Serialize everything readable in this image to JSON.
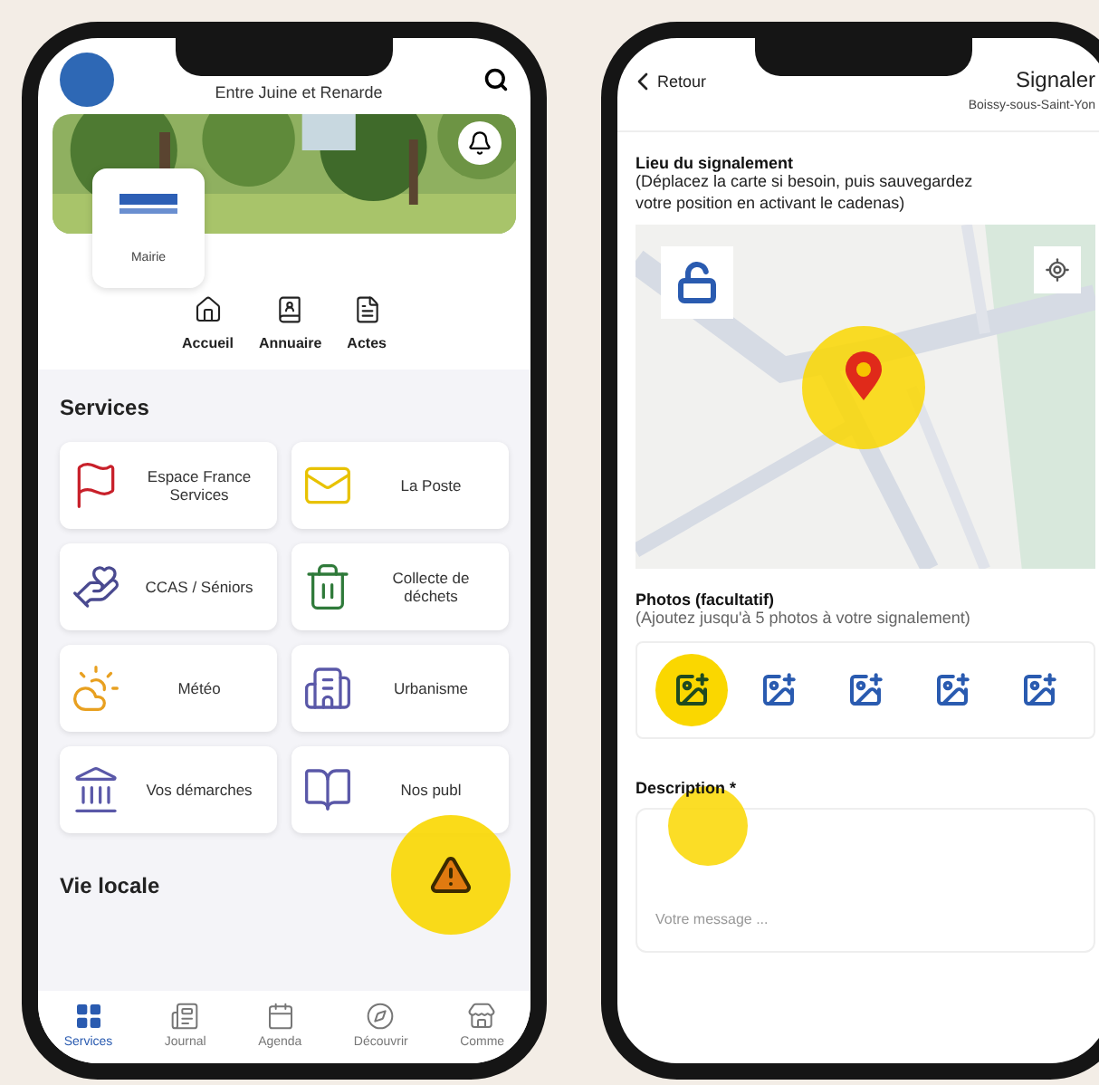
{
  "home_screen": {
    "header": {
      "subtitle": "Entre Juine et Renarde"
    },
    "mairie_card": {
      "label": "Mairie"
    },
    "quick_actions": [
      {
        "label": "Accueil"
      },
      {
        "label": "Annuaire"
      },
      {
        "label": "Actes"
      }
    ],
    "services": {
      "title": "Services",
      "items": [
        {
          "label": "Espace France Services"
        },
        {
          "label": "La Poste"
        },
        {
          "label": "CCAS / Séniors"
        },
        {
          "label": "Collecte de déchets"
        },
        {
          "label": "Météo"
        },
        {
          "label": "Urbanisme"
        },
        {
          "label": "Vos démarches"
        },
        {
          "label": "Nos publ"
        }
      ]
    },
    "report_button": {
      "highlighted": true
    },
    "next_section": "Vie locale",
    "tabs": [
      {
        "label": "Services",
        "selected": true
      },
      {
        "label": "Journal",
        "selected": false
      },
      {
        "label": "Agenda",
        "selected": false
      },
      {
        "label": "Découvrir",
        "selected": false
      },
      {
        "label": "Comme",
        "selected": false
      }
    ]
  },
  "report_screen": {
    "back": "Retour",
    "title": "Signaler",
    "subtitle": "Boissy-sous-Saint-Yon",
    "location": {
      "title": "Lieu du signalement",
      "hint": "(Déplacez la carte si besoin, puis sauvegardez votre position en activant le cadenas)",
      "locked": false,
      "pin_highlighted": true
    },
    "photos": {
      "title": "Photos (facultatif)",
      "hint": "(Ajoutez jusqu'à 5 photos à votre signalement)",
      "slots": [
        {
          "highlighted": true
        },
        {
          "highlighted": false
        },
        {
          "highlighted": false
        },
        {
          "highlighted": false
        },
        {
          "highlighted": false
        }
      ]
    },
    "description": {
      "label": "Description *",
      "highlighted": true,
      "placeholder": "Votre message ..."
    }
  }
}
